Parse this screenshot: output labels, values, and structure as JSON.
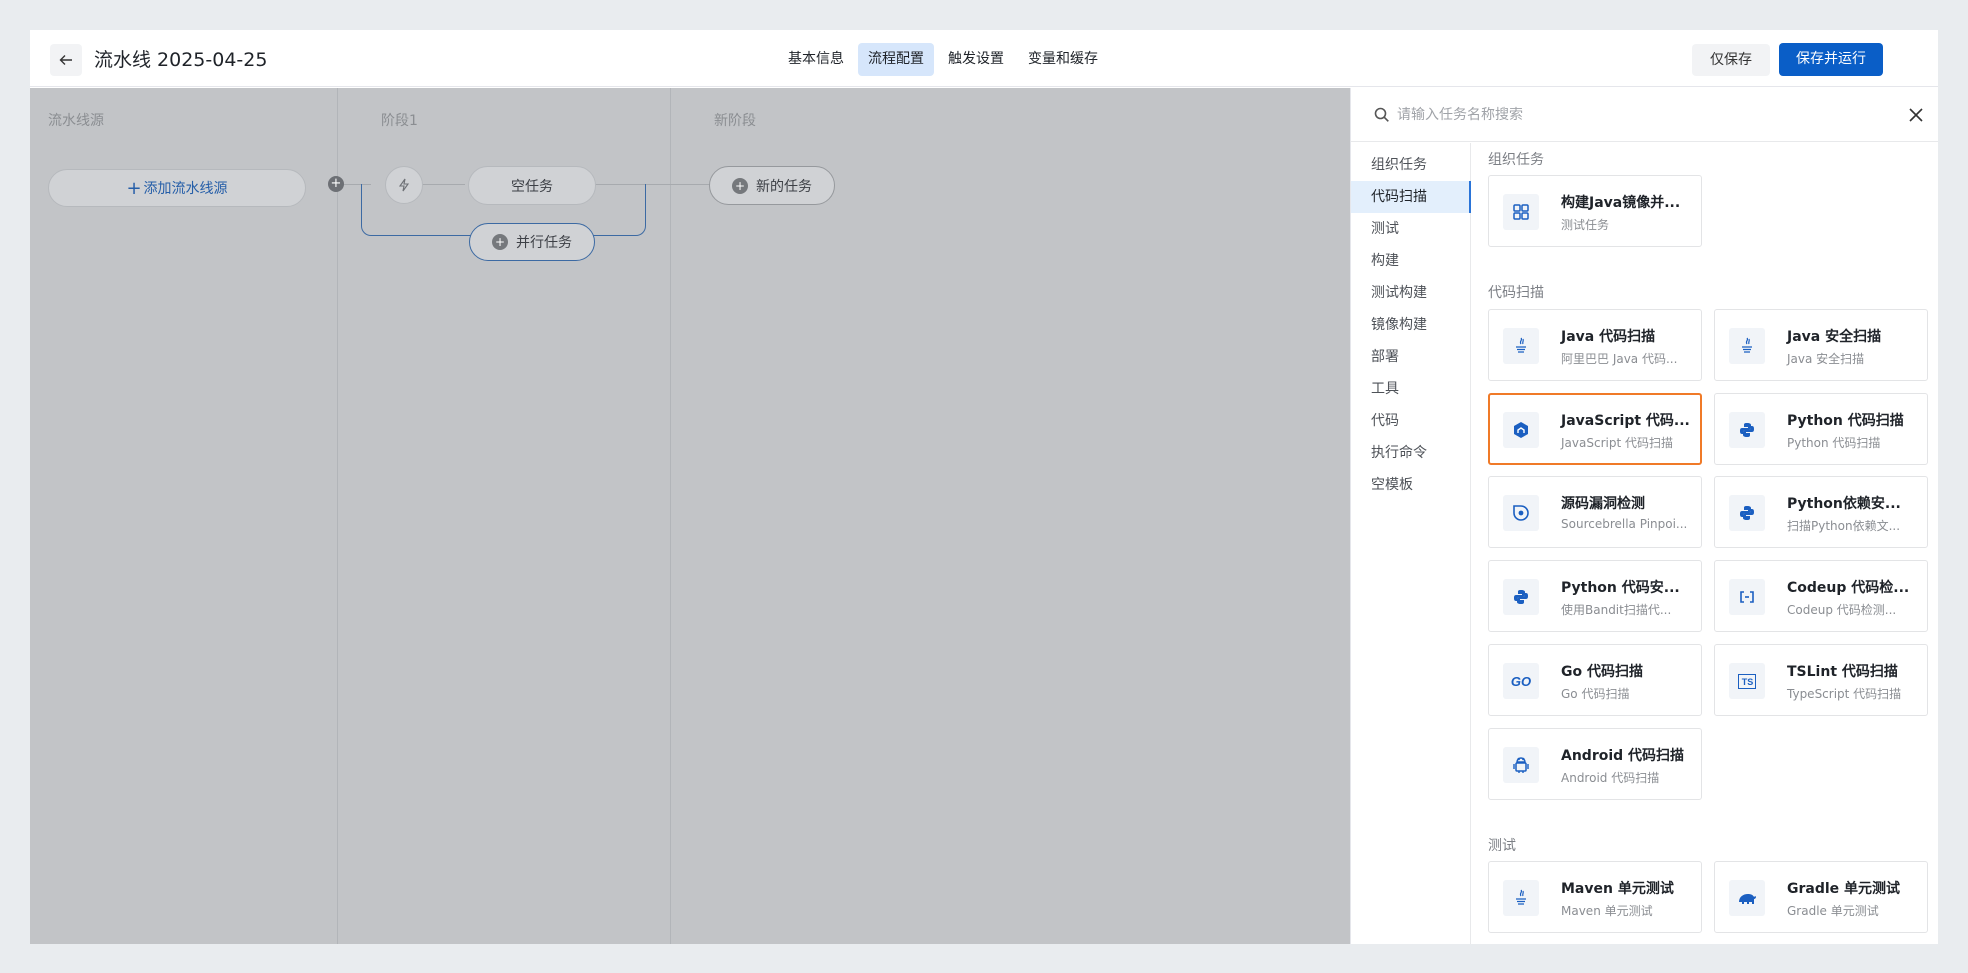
{
  "header": {
    "title": "流水线 2025-04-25",
    "tabs": [
      {
        "label": "基本信息"
      },
      {
        "label": "流程配置",
        "active": true
      },
      {
        "label": "触发设置"
      },
      {
        "label": "变量和缓存"
      }
    ],
    "save_label": "仅保存",
    "save_run_label": "保存并运行"
  },
  "canvas": {
    "stages": [
      {
        "title": "流水线源"
      },
      {
        "title": "阶段1"
      },
      {
        "title": "新阶段"
      }
    ],
    "add_source_label": "添加流水线源",
    "empty_task_label": "空任务",
    "parallel_task_label": "并行任务",
    "new_task_label": "新的任务"
  },
  "panel": {
    "search_placeholder": "请输入任务名称搜索",
    "categories": [
      "组织任务",
      "代码扫描",
      "测试",
      "构建",
      "测试构建",
      "镜像构建",
      "部署",
      "工具",
      "代码",
      "执行命令",
      "空模板"
    ],
    "active_category": "代码扫描",
    "sections": [
      {
        "title": "组织任务",
        "items": [
          {
            "name": "构建Java镜像并...",
            "desc": "测试任务",
            "icon": "grid-icon"
          }
        ]
      },
      {
        "title": "代码扫描",
        "items": [
          {
            "name": "Java 代码扫描",
            "desc": "阿里巴巴 Java 代码...",
            "icon": "java-icon"
          },
          {
            "name": "Java 安全扫描",
            "desc": "Java 安全扫描",
            "icon": "java-icon"
          },
          {
            "name": "JavaScript 代码...",
            "desc": "JavaScript 代码扫描",
            "icon": "js-hex-icon",
            "highlighted": true
          },
          {
            "name": "Python 代码扫描",
            "desc": "Python 代码扫描",
            "icon": "python-icon"
          },
          {
            "name": "源码漏洞检测",
            "desc": "Sourcebrella Pinpoi...",
            "icon": "pinpoint-icon"
          },
          {
            "name": "Python依赖安...",
            "desc": "扫描Python依赖文...",
            "icon": "python-icon"
          },
          {
            "name": "Python 代码安...",
            "desc": "使用Bandit扫描代...",
            "icon": "python-icon"
          },
          {
            "name": "Codeup 代码检...",
            "desc": "Codeup 代码检测...",
            "icon": "codeup-icon"
          },
          {
            "name": "Go 代码扫描",
            "desc": "Go 代码扫描",
            "icon": "go-icon"
          },
          {
            "name": "TSLint 代码扫描",
            "desc": "TypeScript 代码扫描",
            "icon": "ts-icon"
          },
          {
            "name": "Android 代码扫描",
            "desc": "Android 代码扫描",
            "icon": "android-icon"
          }
        ]
      },
      {
        "title": "测试",
        "items": [
          {
            "name": "Maven 单元测试",
            "desc": "Maven 单元测试",
            "icon": "java-icon"
          },
          {
            "name": "Gradle 单元测试",
            "desc": "Gradle 单元测试",
            "icon": "gradle-icon"
          }
        ]
      }
    ]
  },
  "colors": {
    "primary": "#0a5ec7",
    "highlight_border": "#f07a28",
    "canvas_bg": "#c2c4c7",
    "active_tab_bg": "#d6e6fb"
  }
}
